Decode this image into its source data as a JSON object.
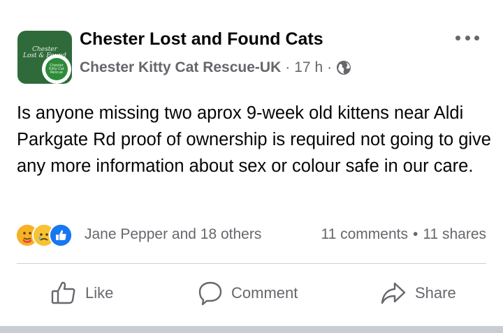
{
  "post": {
    "group_name": "Chester Lost and Found Cats",
    "author": "Chester Kitty Cat Rescue-UK",
    "time": "17 h",
    "separator": "·",
    "avatar_text_line1": "Chester",
    "avatar_text_line2": "Lost & Found",
    "badge_text": "Chester Kitty Cat Rescue",
    "body": "Is anyone missing two aprox 9-week old kittens near Aldi Parkgate Rd proof of ownership is required not going to give any more information about sex or colour safe in our care.",
    "reactions": [
      "care-icon",
      "sad-icon",
      "like-icon"
    ],
    "reaction_names": "Jane Pepper and 18 others",
    "comments": "11 comments",
    "counts_separator": "•",
    "shares": "11 shares"
  },
  "actions": {
    "like": "Like",
    "comment": "Comment",
    "share": "Share"
  },
  "colors": {
    "secondary_text": "#65676b",
    "like_blue": "#1877f2",
    "avatar_green": "#2f6b3a"
  }
}
